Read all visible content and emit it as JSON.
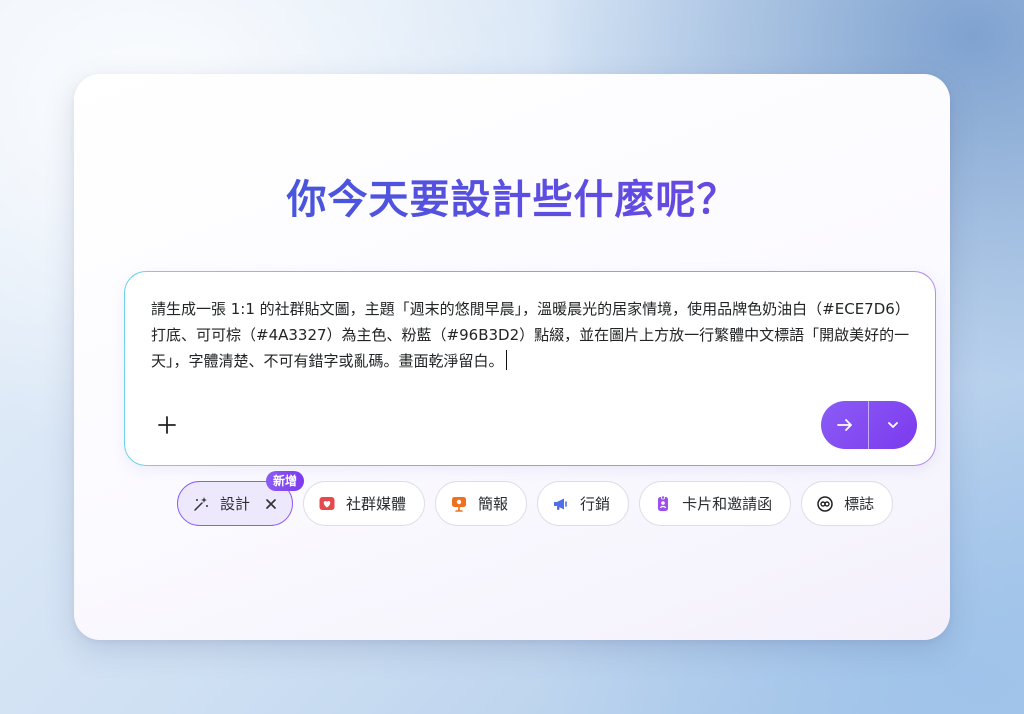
{
  "heading": "你今天要設計些什麼呢？",
  "prompt": {
    "text": "請生成一張 1:1 的社群貼文圖，主題「週末的悠閒早晨」，溫暖晨光的居家情境，使用品牌色奶油白（#ECE7D6）打底、可可棕（#4A3327）為主色、粉藍（#96B3D2）點綴，並在圖片上方放一行繁體中文標語「開啟美好的一天」，字體清楚、不可有錯字或亂碼。畫面乾淨留白。"
  },
  "actions": {
    "add_icon": "plus-icon",
    "send_icon": "arrow-right-icon",
    "options_icon": "chevron-down-icon"
  },
  "chips": [
    {
      "label": "設計",
      "icon": "sparkle-wand-icon",
      "active": true,
      "badge": "新增",
      "close_icon": "close-icon"
    },
    {
      "label": "社群媒體",
      "icon": "heart-icon",
      "color": "#e5484d"
    },
    {
      "label": "簡報",
      "icon": "presentation-icon",
      "color": "#f0701e"
    },
    {
      "label": "行銷",
      "icon": "megaphone-icon",
      "color": "#4f6fe8"
    },
    {
      "label": "卡片和邀請函",
      "icon": "badge-card-icon",
      "color": "#9b4ff0"
    },
    {
      "label": "標誌",
      "icon": "logo-icon",
      "color": "#222222"
    }
  ],
  "colors": {
    "accent": "#7c3aed",
    "title_gradient_start": "#2e5fd6",
    "title_gradient_end": "#7a3fe0"
  }
}
